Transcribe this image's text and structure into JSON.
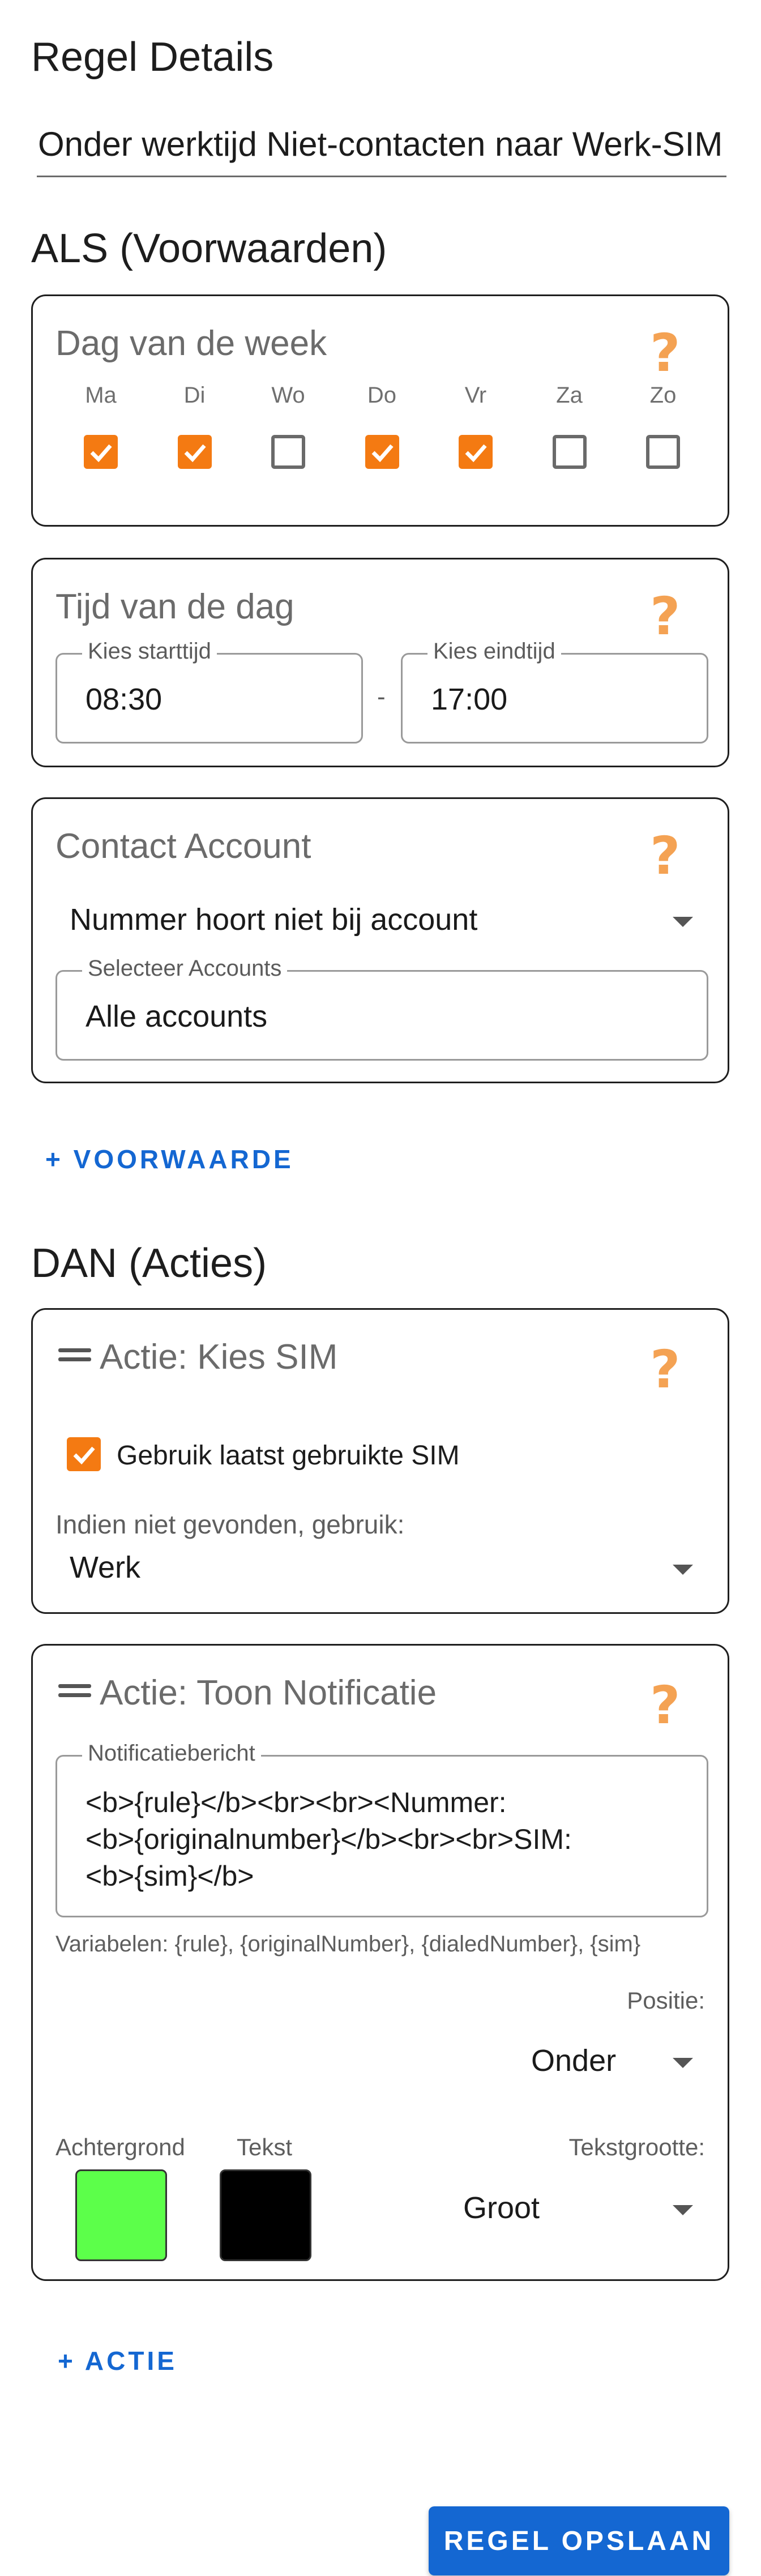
{
  "page": {
    "title": "Regel Details",
    "rule_name": "Onder werktijd Niet-contacten naar Werk-SIM"
  },
  "conditions": {
    "heading": "ALS (Voorwaarden)",
    "day_of_week": {
      "title": "Dag van de week",
      "days": [
        {
          "label": "Ma",
          "checked": true
        },
        {
          "label": "Di",
          "checked": true
        },
        {
          "label": "Wo",
          "checked": false
        },
        {
          "label": "Do",
          "checked": true
        },
        {
          "label": "Vr",
          "checked": true
        },
        {
          "label": "Za",
          "checked": false
        },
        {
          "label": "Zo",
          "checked": false
        }
      ]
    },
    "time_of_day": {
      "title": "Tijd van de dag",
      "start_label": "Kies starttijd",
      "start_value": "08:30",
      "separator": "-",
      "end_label": "Kies eindtijd",
      "end_value": "17:00"
    },
    "contact_account": {
      "title": "Contact Account",
      "match_value": "Nummer hoort niet bij account",
      "accounts_label": "Selecteer Accounts",
      "accounts_value": "Alle accounts"
    },
    "add_label": "+ VOORWAARDE"
  },
  "actions": {
    "heading": "DAN (Acties)",
    "choose_sim": {
      "title": "Actie: Kies SIM",
      "use_last_label": "Gebruik laatst gebruikte SIM",
      "use_last_checked": true,
      "fallback_label": "Indien niet gevonden, gebruik:",
      "fallback_value": "Werk"
    },
    "show_notification": {
      "title": "Actie: Toon Notificatie",
      "message_label": "Notificatiebericht",
      "message_line1": "<b>{rule}</b><br><br><Nummer:",
      "message_line2": "<b>{originalnumber}</b><br><br>SIM:",
      "message_line3": "<b>{sim}</b>",
      "variables_text": "Variabelen: {rule}, {originalNumber}, {dialedNumber}, {sim}",
      "position_label": "Positie:",
      "position_value": "Onder",
      "background_label": "Achtergrond",
      "background_color": "#5cff4a",
      "text_label": "Tekst",
      "text_color": "#000000",
      "text_size_label": "Tekstgrootte:",
      "text_size_value": "Groot"
    },
    "add_label": "+ ACTIE"
  },
  "save_label": "REGEL OPSLAAN",
  "colors": {
    "accent": "#1467d2",
    "checkbox": "#f47a12",
    "help": "#f4a253"
  },
  "icons": {
    "help": "?",
    "drag": "drag-handle-icon",
    "dropdown": "chevron-down-icon"
  }
}
